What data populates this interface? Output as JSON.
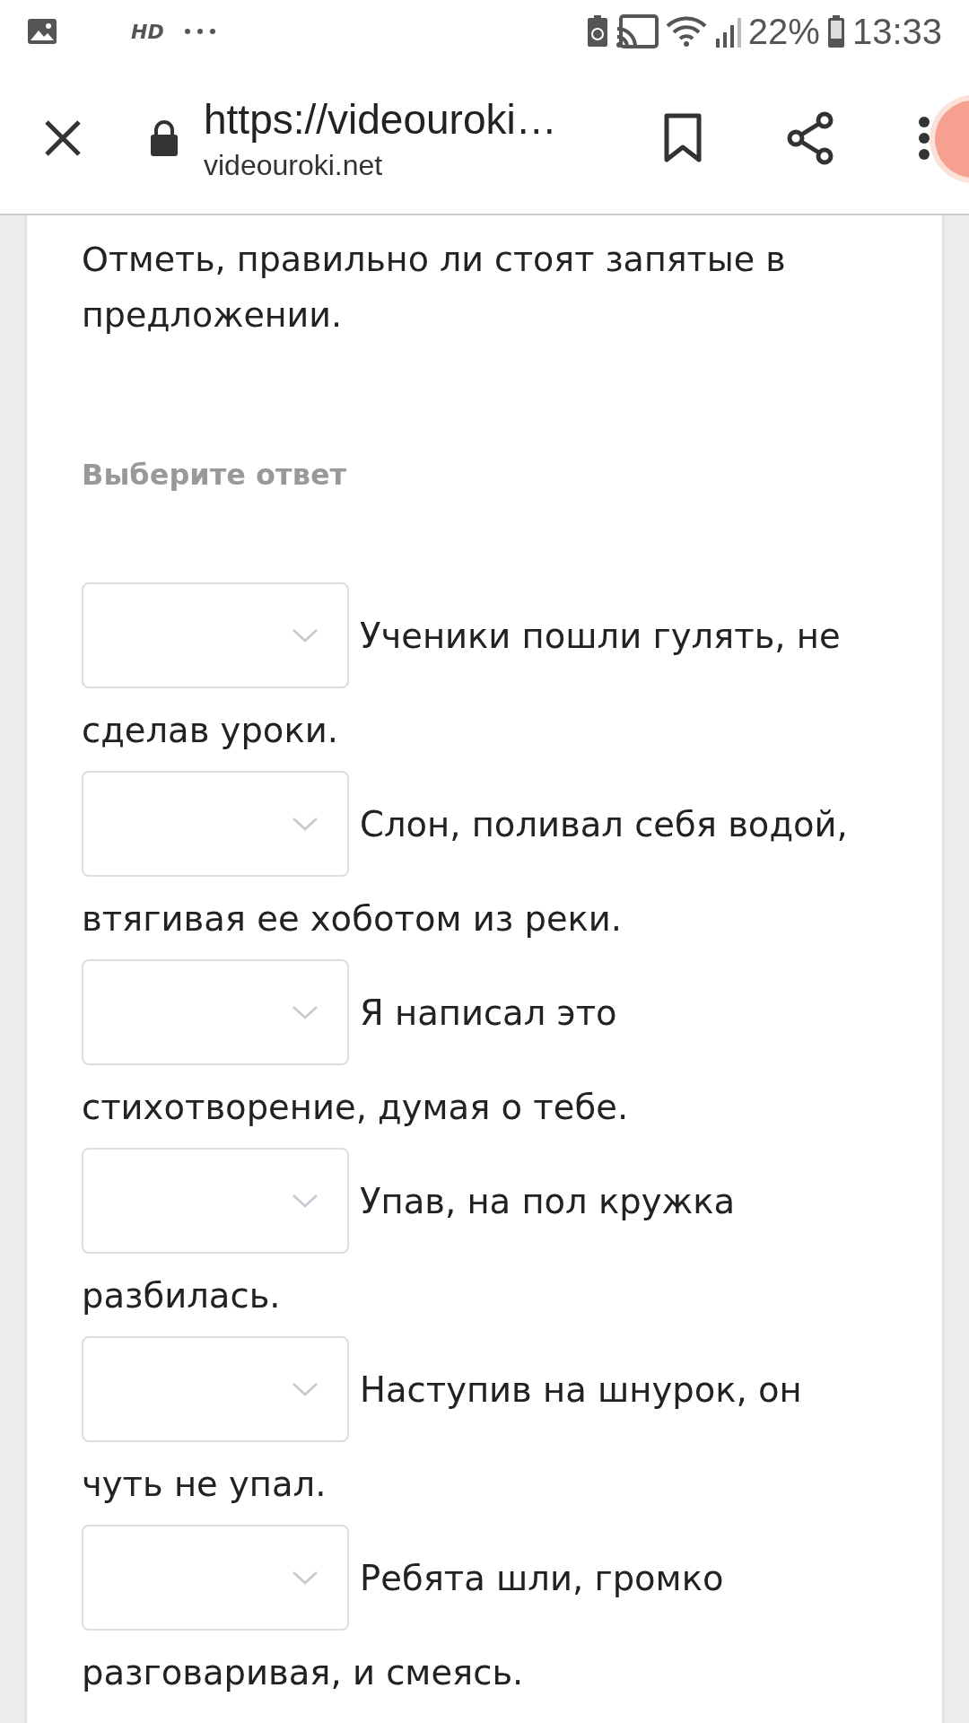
{
  "status_bar": {
    "hd": "HD",
    "battery": "22%",
    "time": "13:33"
  },
  "toolbar": {
    "title": "https://videouroki…",
    "domain": "videouroki.net"
  },
  "question": "Отметь, правильно ли стоят запятые в предложении.",
  "prompt": "Выберите ответ",
  "items": [
    {
      "sentence_start": "Ученики пошли гулять, не",
      "sentence_end": "сделав уроки."
    },
    {
      "sentence_start": "Слон, поливал себя водой,",
      "sentence_end": "втягивая ее хоботом из реки."
    },
    {
      "sentence_start": "Я написал это",
      "sentence_end": "стихотворение, думая о тебе."
    },
    {
      "sentence_start": "Упав, на пол кружка",
      "sentence_end": "разбилась."
    },
    {
      "sentence_start": "Наступив на шнурок, он",
      "sentence_end": "чуть не упал."
    },
    {
      "sentence_start": "Ребята шли, громко",
      "sentence_end": "разговаривая, и смеясь."
    }
  ]
}
